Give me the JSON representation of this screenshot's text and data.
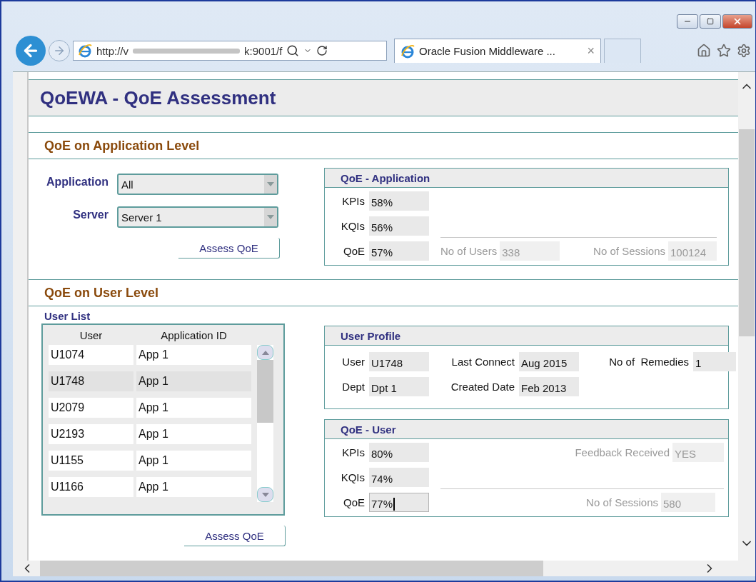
{
  "browser": {
    "url_start": "http://v",
    "url_end": "k:9001/f",
    "tab_title": "Oracle Fusion Middleware ...",
    "tab_close": "×"
  },
  "page": {
    "title": "QoEWA - QoE Assessment"
  },
  "app_section": {
    "title": "QoE on Application Level",
    "filters": [
      {
        "label": "Application",
        "value": "All"
      },
      {
        "label": "Server",
        "value": "Server 1"
      }
    ],
    "button": "Assess QoE",
    "panel": {
      "title": "QoE - Application",
      "metrics": [
        {
          "label": "KPIs",
          "value": "58%"
        },
        {
          "label": "KQIs",
          "value": "56%"
        },
        {
          "label": "QoE",
          "value": "57%"
        }
      ],
      "stats": [
        {
          "label": "No of Users",
          "value": "338"
        },
        {
          "label": "No of Sessions",
          "value": "100124"
        }
      ]
    }
  },
  "user_section": {
    "title": "QoE on User Level",
    "list_title": "User List",
    "columns": [
      "User",
      "Application ID"
    ],
    "rows": [
      {
        "user": "U1074",
        "app": "App 1",
        "selected": false
      },
      {
        "user": "U1748",
        "app": "App 1",
        "selected": true
      },
      {
        "user": "U2079",
        "app": "App 1",
        "selected": false
      },
      {
        "user": "U2193",
        "app": "App 1",
        "selected": false
      },
      {
        "user": "U1155",
        "app": "App 1",
        "selected": false
      },
      {
        "user": "U1166",
        "app": "App 1",
        "selected": false
      }
    ],
    "button": "Assess QoE",
    "profile": {
      "title": "User Profile",
      "fields": [
        {
          "label": "User",
          "value": "U1748"
        },
        {
          "label": "Last Connect",
          "value": "Aug 2015"
        },
        {
          "label": "No of  Remedies",
          "value": "1"
        },
        {
          "label": "Dept",
          "value": "Dpt 1"
        },
        {
          "label": "Created Date",
          "value": "Feb 2013"
        }
      ]
    },
    "qoe_user": {
      "title": "QoE - User",
      "metrics": [
        {
          "label": "KPIs",
          "value": "80%",
          "focused": false
        },
        {
          "label": "KQIs",
          "value": "74%",
          "focused": false
        },
        {
          "label": "QoE",
          "value": "77%",
          "focused": true
        }
      ],
      "feedback": {
        "label": "Feedback Received",
        "value": "YES"
      },
      "sessions": {
        "label": "No of Sessions",
        "value": "580"
      }
    }
  }
}
